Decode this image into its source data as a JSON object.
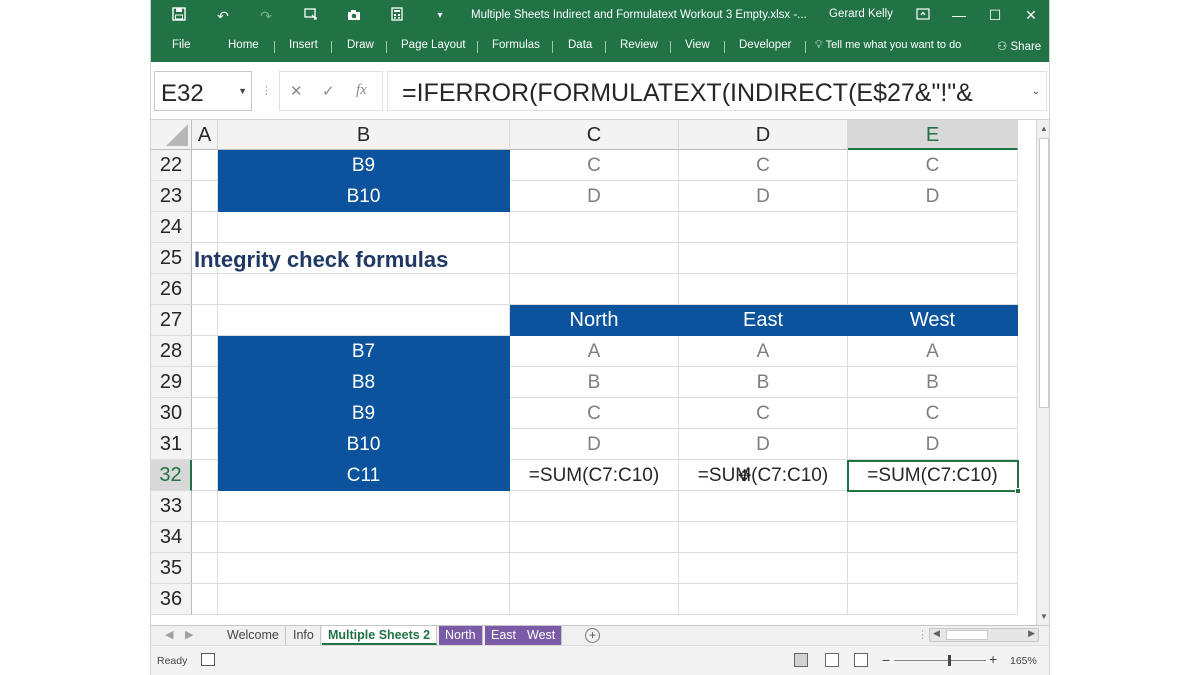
{
  "quick_access": {
    "save": "save-icon",
    "undo": "undo-icon",
    "redo": "redo-icon",
    "touch": "touch-mode-icon",
    "camera": "camera-icon",
    "calculator": "calculator-icon",
    "customize": "customize-icon"
  },
  "title": "Multiple Sheets Indirect and Formulatext Workout 3 Empty.xlsx  -...",
  "user": "Gerard Kelly",
  "ribbon_tabs": [
    "File",
    "Home",
    "Insert",
    "Draw",
    "Page Layout",
    "Formulas",
    "Data",
    "Review",
    "View",
    "Developer"
  ],
  "tell_me": "Tell me what you want to do",
  "share": "Share",
  "name_box": "E32",
  "formula_icons": {
    "cancel": "✕",
    "enter": "✓",
    "fx": "fx"
  },
  "formula": "=IFERROR(FORMULATEXT(INDIRECT(E$27&\"!\"&",
  "columns": [
    "A",
    "B",
    "C",
    "D",
    "E"
  ],
  "rows": [
    "22",
    "23",
    "24",
    "25",
    "26",
    "27",
    "28",
    "29",
    "30",
    "31",
    "32",
    "33",
    "34",
    "35",
    "36"
  ],
  "cells": {
    "r22": {
      "B": "B9",
      "C": "C",
      "D": "C",
      "E": "C"
    },
    "r23": {
      "B": "B10",
      "C": "D",
      "D": "D",
      "E": "D"
    },
    "r25": {
      "A": "Integrity check formulas"
    },
    "r27": {
      "C": "North",
      "D": "East",
      "E": "West"
    },
    "r28": {
      "B": "B7",
      "C": "A",
      "D": "A",
      "E": "A"
    },
    "r29": {
      "B": "B8",
      "C": "B",
      "D": "B",
      "E": "B"
    },
    "r30": {
      "B": "B9",
      "C": "C",
      "D": "C",
      "E": "C"
    },
    "r31": {
      "B": "B10",
      "C": "D",
      "D": "D",
      "E": "D"
    },
    "r32": {
      "B": "C11",
      "C": "=SUM(C7:C10)",
      "D": "=SUM(C7:C10)",
      "E": "=SUM(C7:C10)"
    }
  },
  "sheet_tabs": [
    "Welcome",
    "Info",
    "Multiple Sheets 2",
    "North",
    "East",
    "West"
  ],
  "active_sheet": "Multiple Sheets 2",
  "status": "Ready",
  "zoom": "165%",
  "colors": {
    "ribbon": "#217346",
    "table_fill": "#0b539c",
    "heading": "#1f3864",
    "sheet_tab_purple": "#7b5aa6"
  }
}
